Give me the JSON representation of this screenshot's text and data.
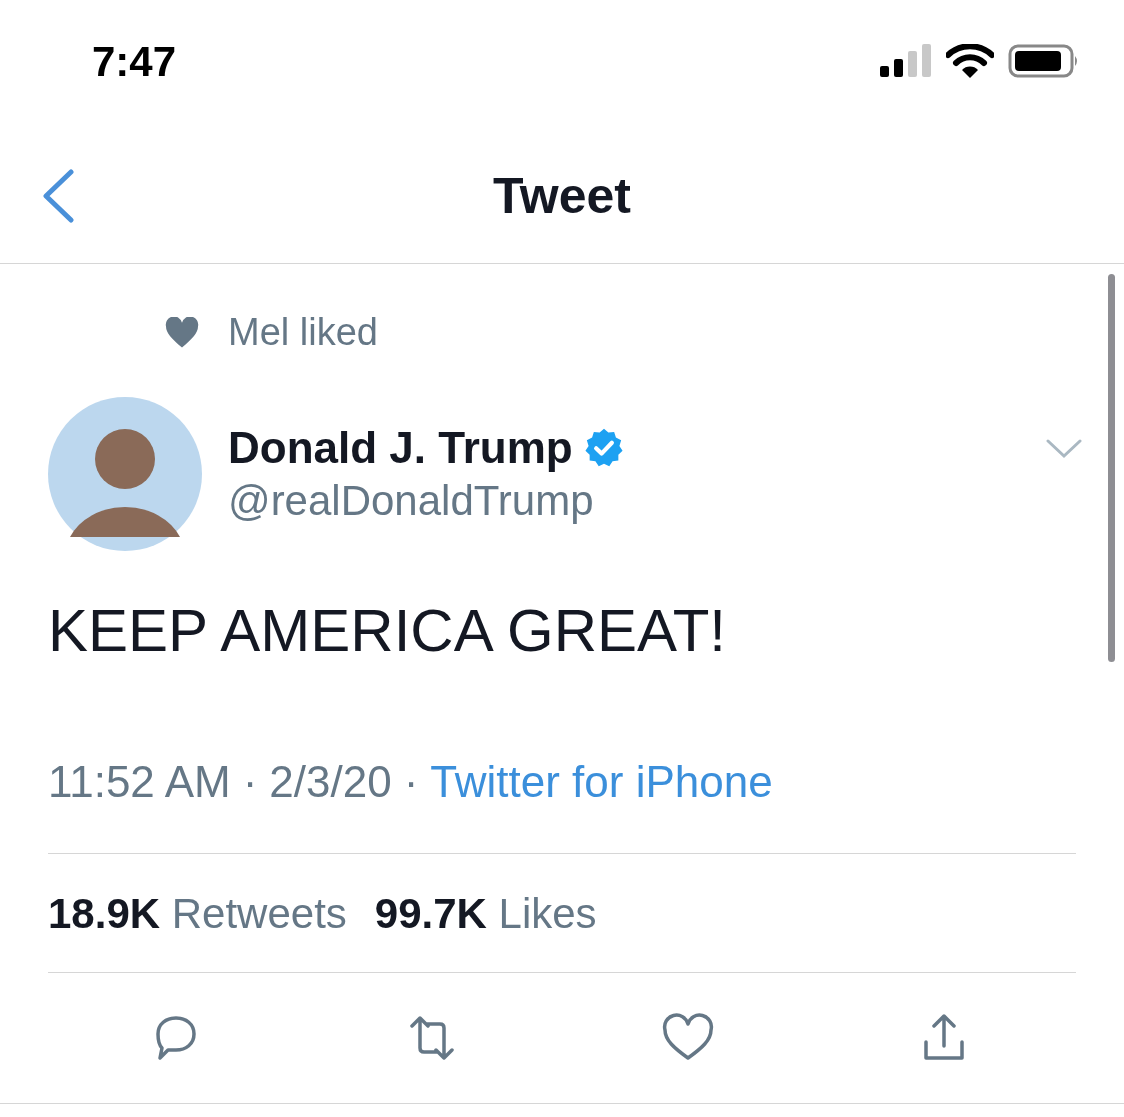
{
  "status_bar": {
    "time": "7:47"
  },
  "nav": {
    "title": "Tweet"
  },
  "social_context": {
    "text": "Mel liked"
  },
  "tweet": {
    "name": "Donald J. Trump",
    "verified": true,
    "handle": "@realDonaldTrump",
    "text": "KEEP AMERICA GREAT!",
    "meta": [
      {
        "kind": "time",
        "text": "11:52 AM"
      },
      {
        "kind": "separator",
        "text": "·"
      },
      {
        "kind": "date",
        "text": "2/3/20"
      },
      {
        "kind": "separator",
        "text": "·"
      },
      {
        "kind": "source",
        "text": "Twitter for iPhone"
      }
    ]
  },
  "stats": [
    {
      "count": "18.9K",
      "label": "Retweets"
    },
    {
      "count": "99.7K",
      "label": "Likes"
    }
  ],
  "actions": [
    {
      "kind": "reply"
    },
    {
      "kind": "retweet"
    },
    {
      "kind": "like"
    },
    {
      "kind": "share"
    }
  ]
}
